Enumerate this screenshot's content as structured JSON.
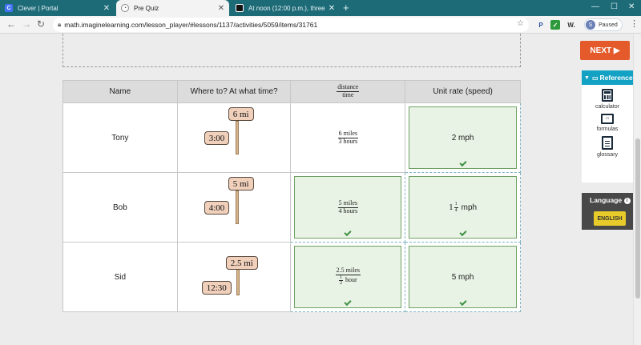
{
  "browser": {
    "tabs": [
      {
        "title": "Clever | Portal",
        "favicon": "clever-icon",
        "active": false
      },
      {
        "title": "Pre Quiz",
        "favicon": "imagine-learning-icon",
        "active": true
      },
      {
        "title": "At noon (12:00 p.m.), three boys",
        "favicon": "brainly-icon",
        "active": false
      }
    ],
    "new_tab_label": "+",
    "url": "math.imaginelearning.com/lesson_player/#lessons/1137/activities/5059/items/31761",
    "profile_initial": "S",
    "profile_status": "Paused",
    "extension_labels": [
      "P",
      "W."
    ]
  },
  "table": {
    "headers": {
      "name": "Name",
      "where": "Where to? At what time?",
      "rate_num": "distance",
      "rate_den": "time",
      "speed": "Unit rate (speed)"
    },
    "rows": [
      {
        "name": "Tony",
        "distance": "6 mi",
        "time": "3:00",
        "ratio_num": "6 miles",
        "ratio_den": "3 hours",
        "speed": "2 mph"
      },
      {
        "name": "Bob",
        "distance": "5 mi",
        "time": "4:00",
        "ratio_num": "5 miles",
        "ratio_den": "4 hours",
        "speed_whole": "1",
        "speed_frac_num": "1",
        "speed_frac_den": "4",
        "speed_unit": "mph"
      },
      {
        "name": "Sid",
        "distance": "2.5 mi",
        "time": "12:30",
        "ratio_num": "2.5 miles",
        "ratio_den_frac_num": "1",
        "ratio_den_frac_den": "2",
        "ratio_den_unit": "hour",
        "speed": "5 mph"
      }
    ]
  },
  "sidebar": {
    "next_label": "NEXT ▶",
    "reference_label": "Reference",
    "tools": [
      {
        "label": "calculator",
        "icon": "calculator-icon"
      },
      {
        "label": "formulas",
        "icon": "formulas-icon"
      },
      {
        "label": "glossary",
        "icon": "glossary-icon"
      }
    ],
    "language_label": "Language",
    "language_button": "ENGLISH"
  },
  "colors": {
    "tabstrip": "#1e6b78",
    "next_button": "#e45a2a",
    "reference_header": "#14a2c4",
    "language_button": "#e8cb2a",
    "answer_fill": "#e9f3e5",
    "answer_border": "#6ea163",
    "sign_fill": "#f0d0bb"
  }
}
